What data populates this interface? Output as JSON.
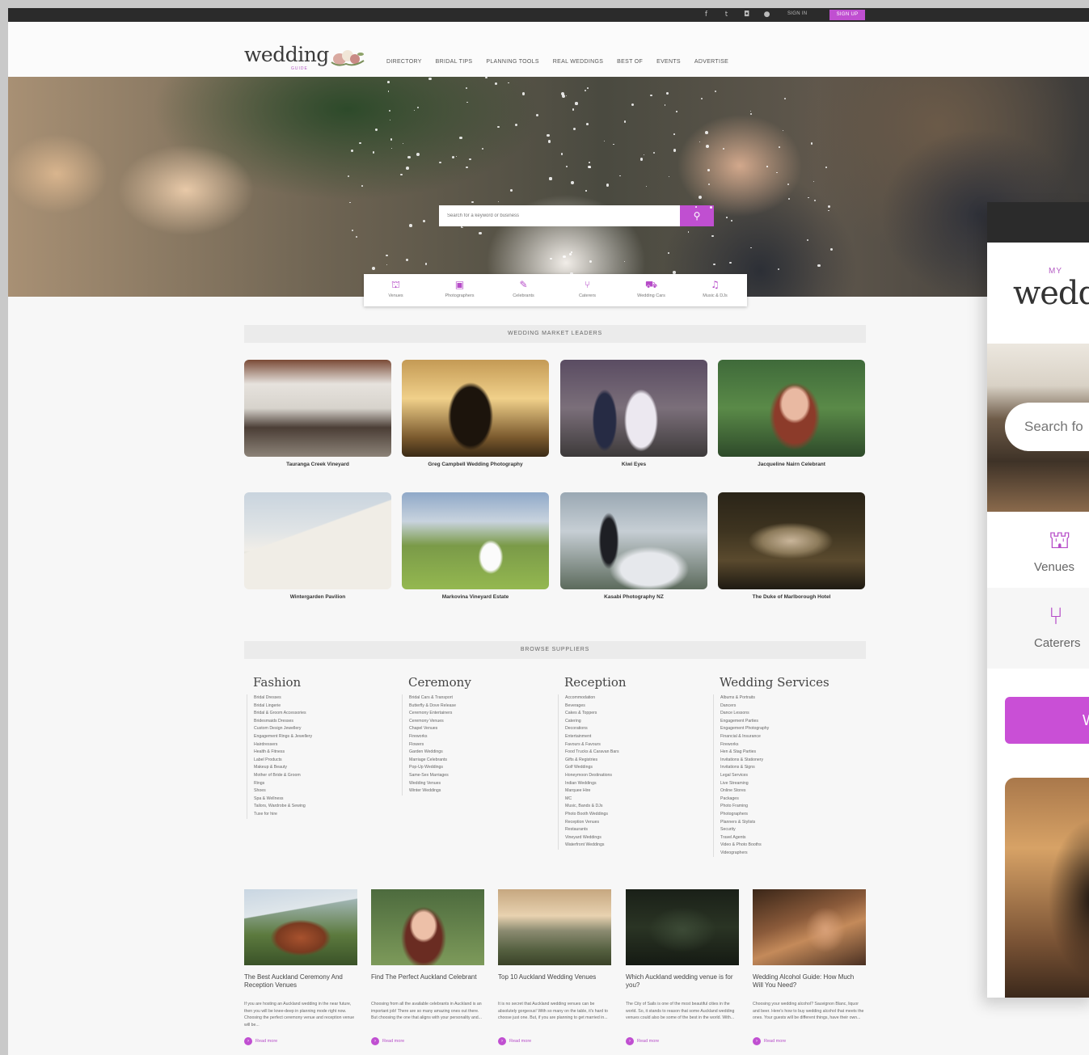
{
  "utilbar": {
    "icons": [
      "facebook-icon",
      "twitter-icon",
      "instagram-icon",
      "pinterest-icon"
    ],
    "signin_label": "SIGN IN",
    "signup_label": "SIGN UP"
  },
  "header": {
    "logo_text": "wedding",
    "logo_sub": "GUIDE",
    "nav": [
      "DIRECTORY",
      "BRIDAL TIPS",
      "PLANNING TOOLS",
      "REAL WEDDINGS",
      "BEST OF",
      "EVENTS",
      "ADVERTISE"
    ]
  },
  "hero": {
    "search_placeholder": "Search for a keyword or business"
  },
  "categories": [
    {
      "label": "Venues",
      "icon": "venue-icon"
    },
    {
      "label": "Photographers",
      "icon": "camera-icon"
    },
    {
      "label": "Celebrants",
      "icon": "pen-icon"
    },
    {
      "label": "Caterers",
      "icon": "cutlery-icon"
    },
    {
      "label": "Wedding Cars",
      "icon": "car-icon"
    },
    {
      "label": "Music & DJs",
      "icon": "music-icon"
    }
  ],
  "market_leaders": {
    "heading": "WEDDING MARKET LEADERS",
    "tiles": [
      {
        "caption": "Tauranga Creek Vineyard"
      },
      {
        "caption": "Greg Campbell Wedding Photography"
      },
      {
        "caption": "Kiwi Eyes"
      },
      {
        "caption": "Jacqueline Nairn Celebrant"
      },
      {
        "caption": "Wintergarden Pavilion"
      },
      {
        "caption": "Markovina Vineyard Estate"
      },
      {
        "caption": "Kasabi Photography NZ"
      },
      {
        "caption": "The Duke of Marlborough Hotel"
      }
    ]
  },
  "browse": {
    "heading": "BROWSE SUPPLIERS",
    "columns": [
      {
        "title": "Fashion",
        "items": [
          "Bridal Dresses",
          "Bridal Lingerie",
          "Bridal & Groom Accessories",
          "Bridesmaids Dresses",
          "Custom Design Jewellery",
          "Engagement Rings & Jewellery",
          "Hairdressers",
          "Health & Fitness",
          "Label Products",
          "Makeup & Beauty",
          "Mother of Bride & Groom",
          "Rings",
          "Shoes",
          "Spa & Wellness",
          "Tailors, Wardrobe & Sewing",
          "Tuxe for hire"
        ]
      },
      {
        "title": "Ceremony",
        "items": [
          "Bridal Cars & Transport",
          "Butterfly & Dove Release",
          "Ceremony Entertainers",
          "Ceremony Venues",
          "Chapel Venues",
          "Fireworks",
          "Flowers",
          "Garden Weddings",
          "Marriage Celebrants",
          "Pop-Up Weddings",
          "Same-Sex Marriages",
          "Wedding Venues",
          "Winter Weddings"
        ]
      },
      {
        "title": "Reception",
        "items": [
          "Accommodation",
          "Beverages",
          "Cakes & Toppers",
          "Catering",
          "Decorations",
          "Entertainment",
          "Favours & Favours",
          "Food Trucks & Caravan Bars",
          "Gifts & Registries",
          "Golf Weddings",
          "Honeymoon Destinations",
          "Indian Weddings",
          "Marquee Hire",
          "MC",
          "Music, Bands & DJs",
          "Photo Booth Weddings",
          "Reception Venues",
          "Restaurants",
          "Vineyard Weddings",
          "Waterfront Weddings"
        ]
      },
      {
        "title": "Wedding Services",
        "items": [
          "Albums & Portraits",
          "Dancers",
          "Dance Lessons",
          "Engagement Parties",
          "Engagement Photography",
          "Financial & Insurance",
          "Fireworks",
          "Hen & Stag Parties",
          "Invitations & Stationery",
          "Invitations & Signs",
          "Legal Services",
          "Live Streaming",
          "Online Stores",
          "Packages",
          "Photo Framing",
          "Photographers",
          "Planners & Stylists",
          "Security",
          "Travel Agents",
          "Video & Photo Booths",
          "Videographers"
        ]
      }
    ]
  },
  "articles": [
    {
      "title": "The Best Auckland Ceremony And Reception Venues",
      "body": "If you are hosting an Auckland wedding in the near future, then you will be knee-deep in planning mode right now. Choosing the perfect ceremony venue and reception venue will be...",
      "more": "Read more"
    },
    {
      "title": "Find The Perfect Auckland Celebrant",
      "body": "Choosing from all the available celebrants in Auckland is an important job! There are so many amazing ones out there. But choosing the one that aligns with your personality and...",
      "more": "Read more"
    },
    {
      "title": "Top 10 Auckland Wedding Venues",
      "body": "It is no secret that Auckland wedding venues can be absolutely gorgeous! With so many on the table, it's hard to choose just one. But, if you are planning to get married in...",
      "more": "Read more"
    },
    {
      "title": "Which Auckland wedding venue is for you?",
      "body": "The City of Sails is one of the most beautiful cities in the world. So, it stands to reason that some Auckland wedding venues could also be some of the best in the world. With...",
      "more": "Read more"
    },
    {
      "title": "Wedding Alcohol Guide: How Much Will You Need?",
      "body": "Choosing your wedding alcohol? Sauvignon Blanc, liquor and beer. Here's how to buy wedding alcohol that meets the ones. Your guests will be different things, have their own...",
      "more": "Read more"
    }
  ],
  "mobile": {
    "logo_text": "wedd",
    "logo_sub": "MY",
    "search_placeholder": "Search fo",
    "cats": [
      {
        "label": "Venues",
        "icon": "venue-icon"
      },
      {
        "label": "Caterers",
        "icon": "cutlery-icon"
      }
    ],
    "button_label": "W"
  },
  "colors": {
    "accent": "#c04fd1",
    "dark": "#2b2b2b"
  }
}
